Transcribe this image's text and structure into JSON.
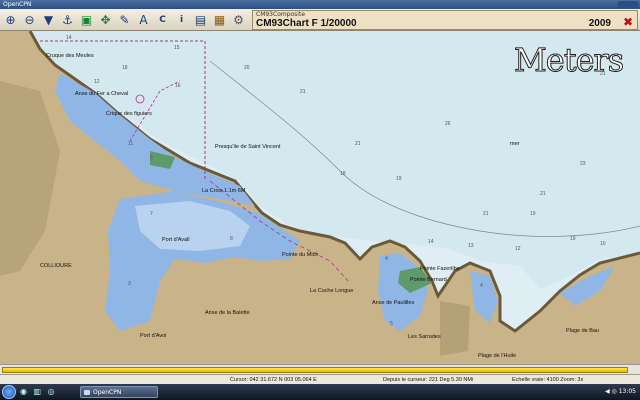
{
  "window": {
    "title": "OpenCPN"
  },
  "chart_info": {
    "source": "CM93Composite",
    "name": "CM93Chart F  1/20000",
    "edition": "2009"
  },
  "units_overlay": "Meters",
  "place_labels": {
    "meules": "Cruque des Meules",
    "anse_fer": "Anse du Fer a Cheval",
    "figuier": "Crique des figuiers",
    "vincent": "Presqu'ile de Saint Vincent",
    "port_avall": "Port d'Avall",
    "collioure": "COLLIOURE",
    "port_vendres": "Pointe du Mich",
    "croix": "La Croix 1.1m 6M",
    "cuche": "La Cuche Longue",
    "balette": "Anse de la Balette",
    "port_avoi": "Port d'Avoi",
    "paulilles": "Anse de Paulilles",
    "sarrades": "Les Sarrades",
    "faz": "Pointe Fazerlibe",
    "bernard": "Pointe Bernard",
    "poule": "Plage de l'Huile",
    "bau": "Plage de Bau",
    "mer": "mer"
  },
  "depths": [
    "14",
    "15",
    "20",
    "21",
    "18",
    "16",
    "12",
    "21",
    "19",
    "11",
    "5",
    "21",
    "23",
    "14",
    "8",
    "21",
    "19",
    "19",
    "13",
    "12",
    "10",
    "21",
    "26",
    "18",
    "7",
    "3",
    "4",
    "4",
    "5"
  ],
  "status": {
    "cursor": "Cursor: 042 31.672 N 003 05.064 E",
    "bearing": "Depuis le curseur: 221 Deg   5.30 NMi",
    "scale": "Echelle vraie:   4100  Zoom:  3x"
  },
  "progress": {
    "value": 0.985
  },
  "taskbar": {
    "quick": "◉ ▥ ◎",
    "app": "OpenCPN",
    "tray": "◀ ◎ 13:05"
  }
}
